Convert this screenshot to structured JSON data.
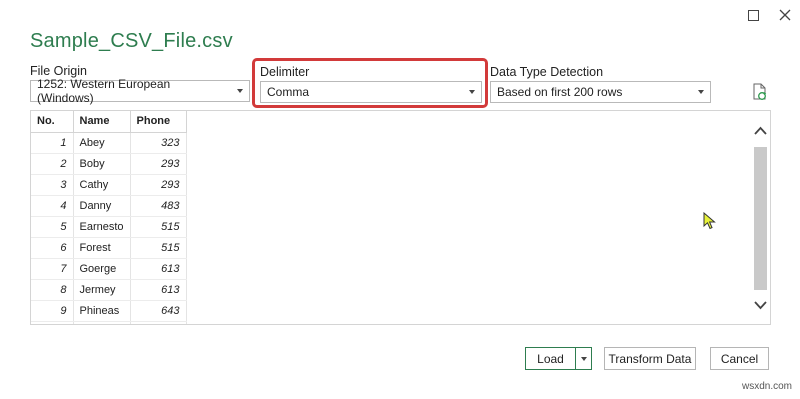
{
  "window": {
    "title": "Sample_CSV_File.csv"
  },
  "file_origin": {
    "label": "File Origin",
    "value": "1252: Western European (Windows)"
  },
  "delimiter": {
    "label": "Delimiter",
    "value": "Comma"
  },
  "data_type_detection": {
    "label": "Data Type Detection",
    "value": "Based on first 200 rows"
  },
  "preview": {
    "columns": [
      "No.",
      "Name",
      "Phone"
    ],
    "rows": [
      {
        "no": "1",
        "name": "Abey",
        "phone": "323"
      },
      {
        "no": "2",
        "name": "Boby",
        "phone": "293"
      },
      {
        "no": "3",
        "name": "Cathy",
        "phone": "293"
      },
      {
        "no": "4",
        "name": "Danny",
        "phone": "483"
      },
      {
        "no": "5",
        "name": "Earnesto",
        "phone": "515"
      },
      {
        "no": "6",
        "name": "Forest",
        "phone": "515"
      },
      {
        "no": "7",
        "name": "Goerge",
        "phone": "613"
      },
      {
        "no": "8",
        "name": "Jermey",
        "phone": "613"
      },
      {
        "no": "9",
        "name": "Phineas",
        "phone": "643"
      }
    ]
  },
  "buttons": {
    "load": "Load",
    "transform": "Transform Data",
    "cancel": "Cancel"
  },
  "watermark": "wsxdn.com",
  "colors": {
    "title_green": "#2e7d4f",
    "highlight_red": "#d23a3a"
  },
  "icons": {
    "maximize": "maximize-icon",
    "close": "close-icon",
    "refresh": "refresh-file-icon",
    "scroll_up": "chevron-up-icon",
    "scroll_down": "chevron-down-icon",
    "cursor": "mouse-pointer-icon"
  }
}
